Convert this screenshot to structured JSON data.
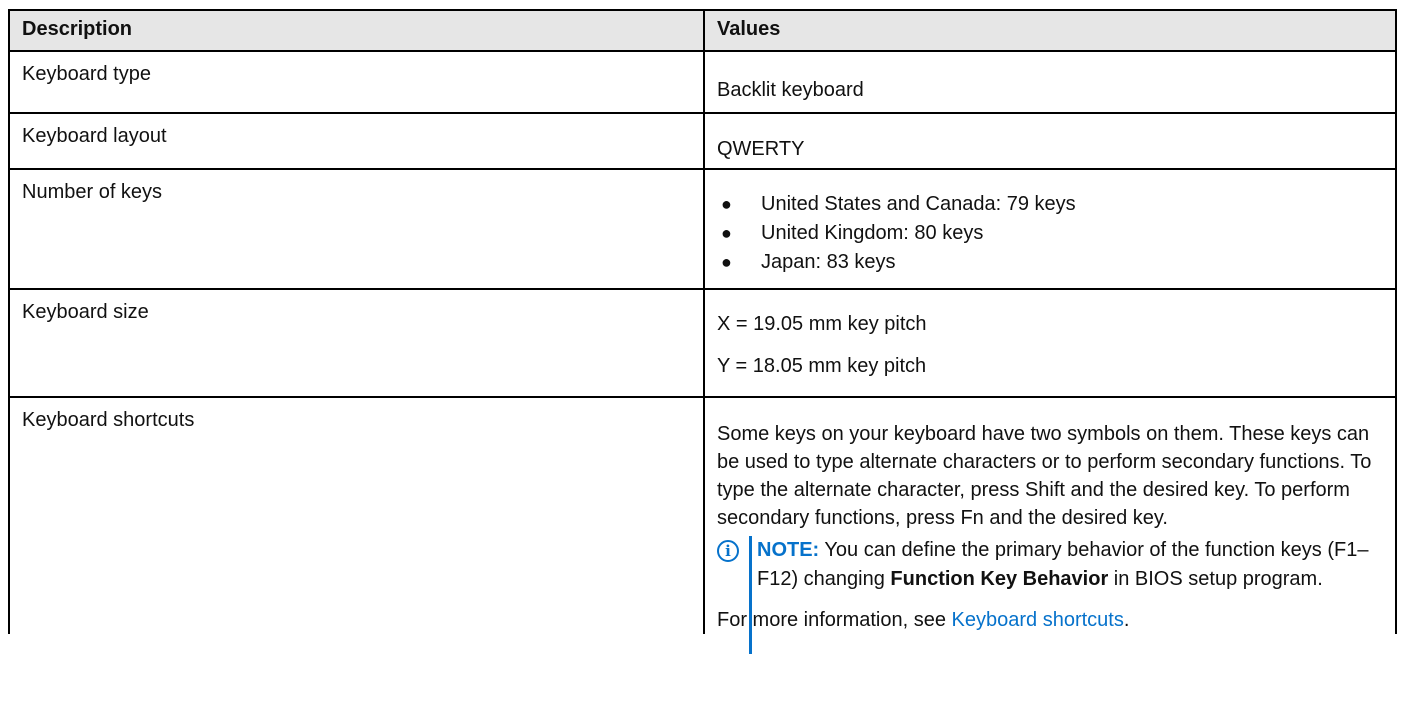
{
  "table": {
    "header": {
      "description": "Description",
      "values": "Values"
    },
    "rows": {
      "keyboard_type": {
        "label": "Keyboard type",
        "value": "Backlit keyboard"
      },
      "keyboard_layout": {
        "label": "Keyboard layout",
        "value": "QWERTY"
      },
      "number_of_keys": {
        "label": "Number of keys",
        "items": [
          "United States and Canada: 79 keys",
          "United Kingdom: 80 keys",
          "Japan: 83 keys"
        ]
      },
      "keyboard_size": {
        "label": "Keyboard size",
        "x": "X = 19.05 mm key pitch",
        "y": "Y = 18.05 mm key pitch"
      },
      "keyboard_shortcuts": {
        "label": "Keyboard shortcuts",
        "paragraph": "Some keys on your keyboard have two symbols on them. These keys can be used to type alternate characters or to perform secondary functions. To type the alternate character, press Shift and the desired key. To perform secondary functions, press Fn and the desired key.",
        "note": {
          "icon": "info-icon",
          "label": "NOTE:",
          "text_before": " You can define the primary behavior of the function keys (F1–F12) changing ",
          "bold": "Function Key Behavior",
          "text_after": " in BIOS setup program."
        },
        "more_before": "For more information, see ",
        "more_link": "Keyboard shortcuts",
        "more_after": "."
      }
    }
  },
  "colors": {
    "header_bg": "#e6e6e6",
    "link": "#0672cb",
    "border": "#000000"
  }
}
